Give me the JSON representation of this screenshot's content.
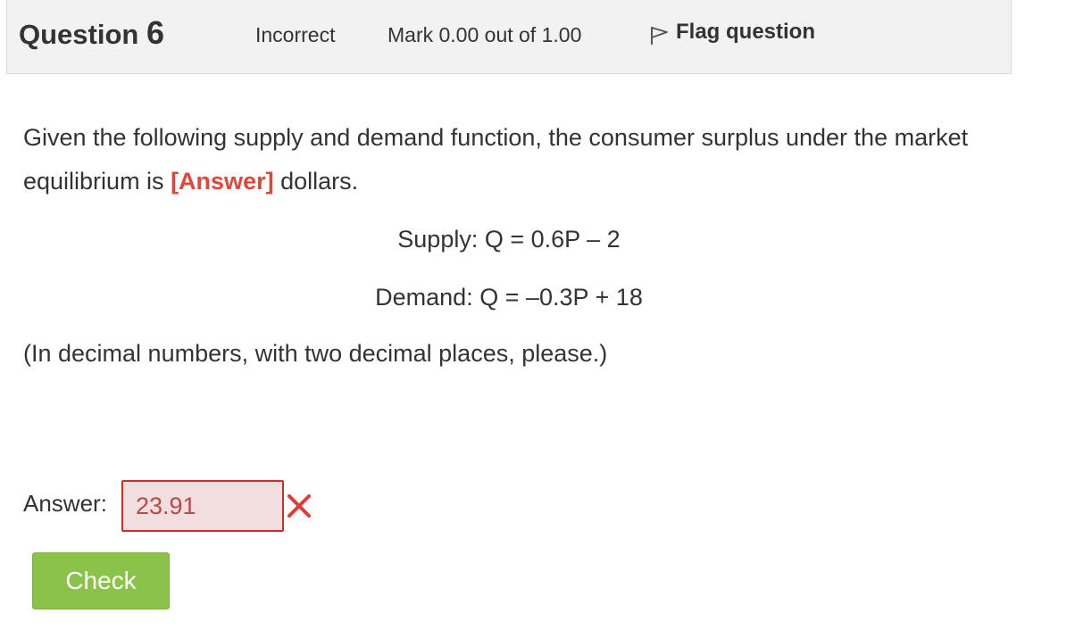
{
  "question_info": {
    "title_prefix": "Question",
    "number": "6",
    "state": "Incorrect",
    "grade": "Mark 0.00 out of 1.00",
    "flag_label": "Flag question"
  },
  "question_text": {
    "part1": "Given the following supply and demand function, the consumer surplus under the market equilibrium is ",
    "answer_placeholder": "[Answer]",
    "part2": " dollars.",
    "supply_eq": "Supply: Q = 0.6P – 2",
    "demand_eq": "Demand: Q = –0.3P + 18",
    "note": "(In decimal numbers, with two decimal places, please.)"
  },
  "answer": {
    "label": "Answer:",
    "value": "23.91",
    "status": "incorrect",
    "icon": "cross-icon"
  },
  "check_button": {
    "label": "Check"
  },
  "colors": {
    "info_bg": "#f2f2f2",
    "answer_tag": "#e0473c",
    "input_bg": "#f2dede",
    "input_border": "#c9302c",
    "wrong_icon": "#e53935",
    "check_bg": "#8bc34a"
  }
}
